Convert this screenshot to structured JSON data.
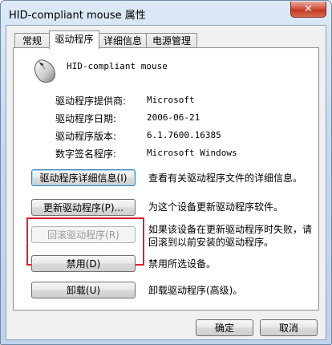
{
  "window": {
    "title": "HID-compliant mouse 属性",
    "close_label": "✕"
  },
  "tabs": [
    {
      "label": "常规"
    },
    {
      "label": "驱动程序",
      "active": true
    },
    {
      "label": "详细信息"
    },
    {
      "label": "电源管理"
    }
  ],
  "device": {
    "icon": "mouse-icon",
    "name": "HID-compliant mouse"
  },
  "info": [
    {
      "label": "驱动程序提供商:",
      "value": "Microsoft"
    },
    {
      "label": "驱动程序日期:",
      "value": "2006-06-21"
    },
    {
      "label": "驱动程序版本:",
      "value": "6.1.7600.16385"
    },
    {
      "label": "数字签名程序:",
      "value": "Microsoft Windows"
    }
  ],
  "actions": [
    {
      "button": "驱动程序详细信息(I)",
      "description": "查看有关驱动程序文件的详细信息。",
      "enabled": true
    },
    {
      "button": "更新驱动程序(P)...",
      "description": "为这个设备更新驱动程序软件。",
      "enabled": true
    },
    {
      "button": "回滚驱动程序(R)",
      "description": "如果该设备在更新驱动程序时失败，请回滚到以前安装的驱动程序。",
      "enabled": false
    },
    {
      "button": "禁用(D)",
      "description": "禁用所选设备。",
      "enabled": true
    },
    {
      "button": "卸载(U)",
      "description": "卸载驱动程序(高级)。",
      "enabled": true
    }
  ],
  "footer": {
    "ok_label": "确定",
    "cancel_label": "取消"
  },
  "colors": {
    "highlight": "#d9232d",
    "close_button": "#c23a24"
  }
}
